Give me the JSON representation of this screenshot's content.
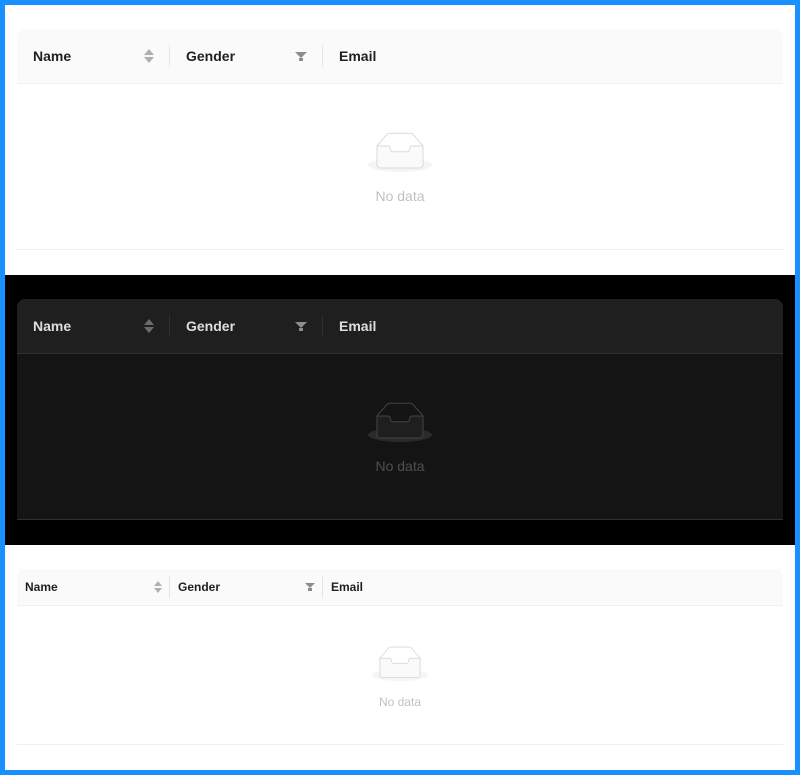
{
  "tables": [
    {
      "columns": {
        "name": "Name",
        "gender": "Gender",
        "email": "Email"
      },
      "empty_text": "No data"
    },
    {
      "columns": {
        "name": "Name",
        "gender": "Gender",
        "email": "Email"
      },
      "empty_text": "No data"
    },
    {
      "columns": {
        "name": "Name",
        "gender": "Gender",
        "email": "Email"
      },
      "empty_text": "No data"
    }
  ],
  "colors": {
    "frame_border": "#1890ff",
    "light_header_bg": "#fafafa",
    "dark_bg": "#000000",
    "dark_table_bg": "#141414",
    "dark_header_bg": "#1f1f1f"
  },
  "icons": {
    "sort": "sort-icon",
    "filter": "filter-icon",
    "empty": "empty-inbox-icon"
  }
}
